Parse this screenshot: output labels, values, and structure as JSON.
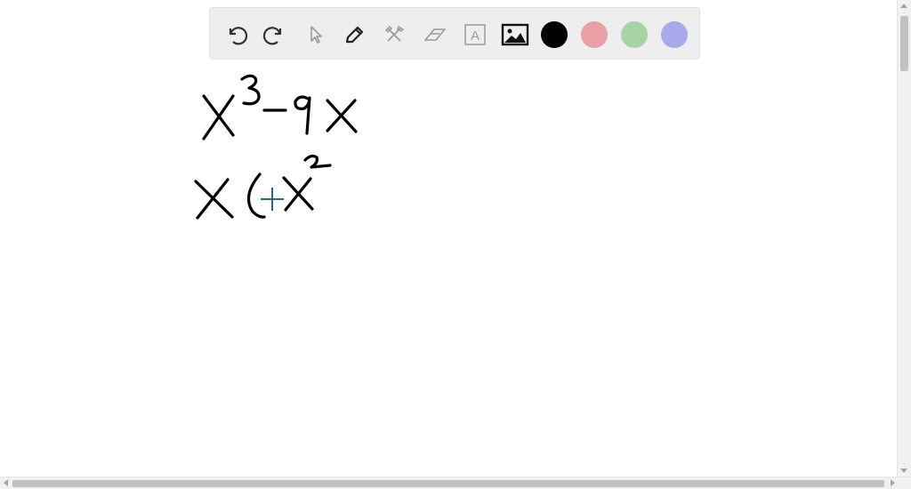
{
  "toolbar": {
    "tools": [
      {
        "name": "undo-icon"
      },
      {
        "name": "redo-icon"
      },
      {
        "name": "select-pointer-icon"
      },
      {
        "name": "pen-icon"
      },
      {
        "name": "tools-icon"
      },
      {
        "name": "eraser-icon"
      },
      {
        "name": "text-tool-icon"
      },
      {
        "name": "image-icon"
      }
    ],
    "colors": {
      "black": "#000000",
      "red": "#e8a0a4",
      "green": "#a6d4a6",
      "blue": "#a8a8ea"
    },
    "text_tool_label": "A"
  },
  "canvas": {
    "handwriting_lines": [
      "X³–9X",
      "X(X²"
    ]
  }
}
